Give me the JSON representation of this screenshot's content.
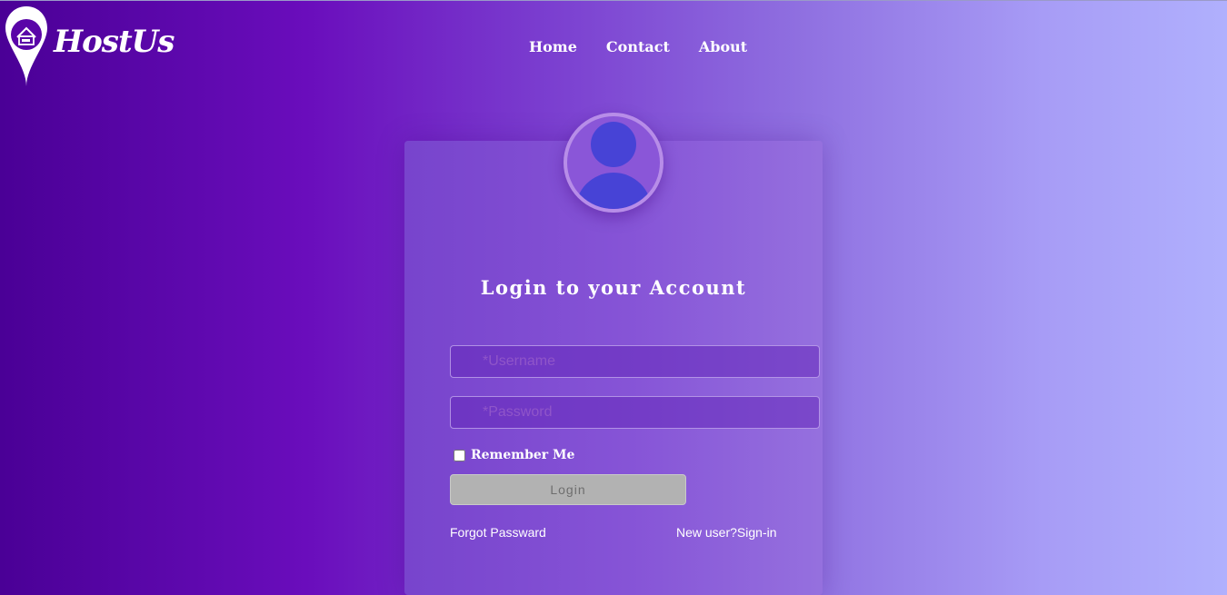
{
  "brand": {
    "name": "HostUs"
  },
  "nav": {
    "home": "Home",
    "contact": "Contact",
    "about": "About"
  },
  "login": {
    "title": "Login to your Account",
    "username_placeholder": "*Username",
    "password_placeholder": "*Password",
    "remember_label": "Remember Me",
    "button_label": "Login",
    "forgot_link": "Forgot Passward",
    "signup_link": "New user?Sign-in"
  },
  "icons": {
    "logo": "map-pin-house-icon",
    "avatar": "user-avatar-icon"
  },
  "colors": {
    "gradient_start": "#4a0096",
    "gradient_end": "#b0b0fd",
    "avatar_fill": "#4743d6",
    "button_bg": "#b2b2b2"
  }
}
